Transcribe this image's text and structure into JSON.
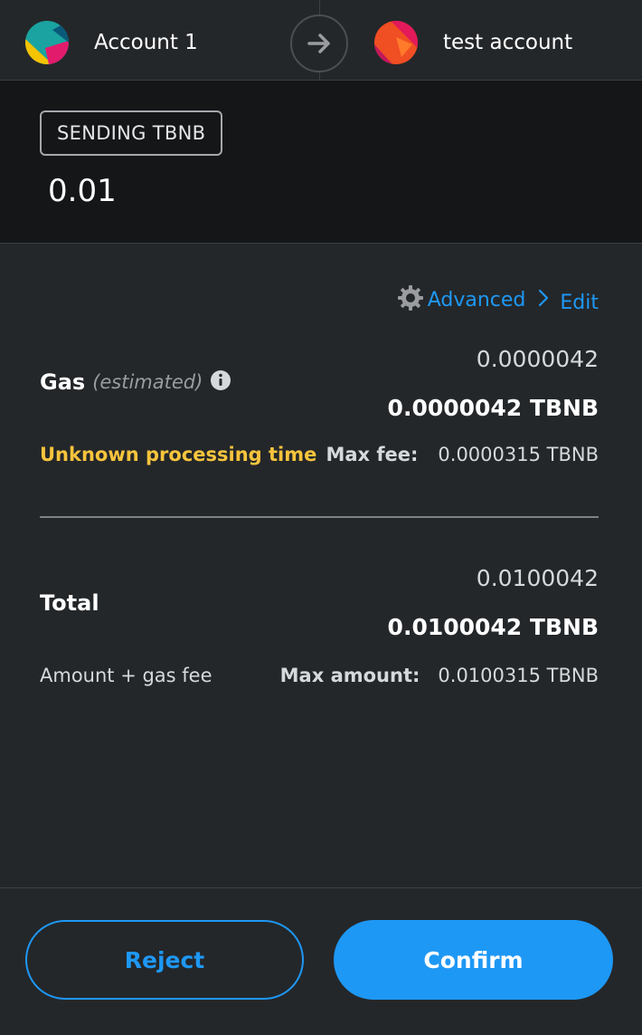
{
  "header": {
    "sender": {
      "name": "Account 1"
    },
    "recipient": {
      "name": "test account"
    }
  },
  "send": {
    "badge": "SENDING TBNB",
    "amount": "0.01"
  },
  "gas": {
    "advanced_label": "Advanced",
    "edit_label": "Edit",
    "title": "Gas",
    "estimated": "(estimated)",
    "fiat_value": "0.0000042",
    "native_value": "0.0000042 TBNB",
    "processing_time": "Unknown processing time",
    "max_fee_label": "Max fee:",
    "max_fee_value": "0.0000315 TBNB"
  },
  "total": {
    "title": "Total",
    "fiat_value": "0.0100042",
    "native_value": "0.0100042 TBNB",
    "subtitle": "Amount + gas fee",
    "max_amount_label": "Max amount:",
    "max_amount_value": "0.0100315 TBNB"
  },
  "footer": {
    "reject_label": "Reject",
    "confirm_label": "Confirm"
  },
  "colors": {
    "primary": "#1e98f5",
    "warning": "#f8c43c",
    "background": "#24272a",
    "send_background": "#141618"
  },
  "icons": {
    "arrow": "arrow-right-icon",
    "gear": "gear-icon",
    "chevron": "chevron-right-icon",
    "info": "info-icon"
  }
}
